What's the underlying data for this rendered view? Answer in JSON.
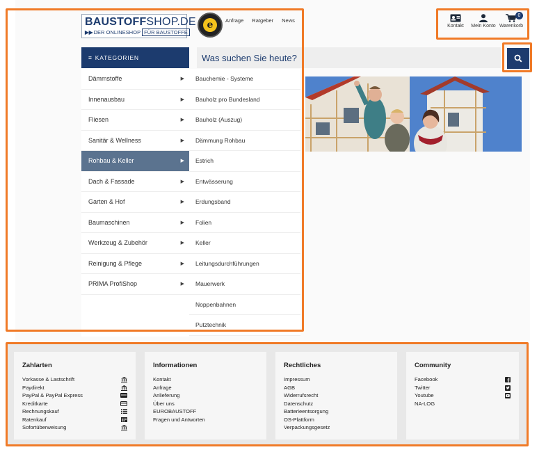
{
  "header": {
    "logo": {
      "top_bold": "BAUSTOFF",
      "top_thin": "SHOP.DE",
      "bottom_a": "DER ONLINESHOP",
      "bottom_b": "FÜR BAUSTOFFE"
    },
    "toplinks": [
      "Anfrage",
      "Ratgeber",
      "News"
    ],
    "iconnav": [
      {
        "label": "Kontakt",
        "icon": "contact-card-icon"
      },
      {
        "label": "Mein Konto",
        "icon": "user-icon"
      },
      {
        "label": "Warenkorb",
        "icon": "cart-icon",
        "badge": "0"
      }
    ]
  },
  "search": {
    "placeholder": "Was suchen Sie heute?"
  },
  "categories": {
    "header": "KATEGORIEN",
    "items": [
      "Dämmstoffe",
      "Innenausbau",
      "Fliesen",
      "Sanitär & Wellness",
      "Rohbau & Keller",
      "Dach & Fassade",
      "Garten & Hof",
      "Baumaschinen",
      "Werkzeug & Zubehör",
      "Reinigung & Pflege",
      "PRIMA ProfiShop"
    ],
    "active_index": 4
  },
  "subcategories": [
    "Bauchemie - Systeme",
    "Bauholz pro Bundesland",
    "Bauholz (Auszug)",
    "Dämmung Rohbau",
    "Estrich",
    "Entwässerung",
    "Erdungsband",
    "Folien",
    "Keller",
    "Leitungsdurchführungen",
    "Mauerwerk",
    "Noppenbahnen",
    "Putztechnik"
  ],
  "footer": {
    "zahlarten": {
      "title": "Zahlarten",
      "items": [
        {
          "label": "Vorkasse & Lastschrift",
          "icon": "bank-icon"
        },
        {
          "label": "Paydirekt",
          "icon": "bank-icon"
        },
        {
          "label": "PayPal & PayPal Express",
          "icon": "paypal-icon"
        },
        {
          "label": "Kreditkarte",
          "icon": "credit-card-icon"
        },
        {
          "label": "Rechnungskauf",
          "icon": "list-icon"
        },
        {
          "label": "Ratenkauf",
          "icon": "calendar-icon"
        },
        {
          "label": "Sofortüberweisung",
          "icon": "bank-icon"
        }
      ]
    },
    "informationen": {
      "title": "Informationen",
      "items": [
        "Kontakt",
        "Anfrage",
        "Anlieferung",
        "Über uns",
        "EUROBAUSTOFF",
        "Fragen und Antworten"
      ]
    },
    "rechtliches": {
      "title": "Rechtliches",
      "items": [
        "Impressum",
        "AGB",
        "Widerrufsrecht",
        "Datenschutz",
        "Batterieentsorgung",
        "OS-Plattform",
        "Verpackungsgesetz"
      ]
    },
    "community": {
      "title": "Community",
      "items": [
        {
          "label": "Facebook",
          "icon": "facebook-icon"
        },
        {
          "label": "Twitter",
          "icon": "twitter-icon"
        },
        {
          "label": "Youtube",
          "icon": "youtube-icon"
        },
        {
          "label": "NA-LOG",
          "icon": ""
        }
      ]
    }
  },
  "colors": {
    "brand": "#1c3b6e",
    "highlight": "#f07a27",
    "active_category": "#5b738f"
  }
}
